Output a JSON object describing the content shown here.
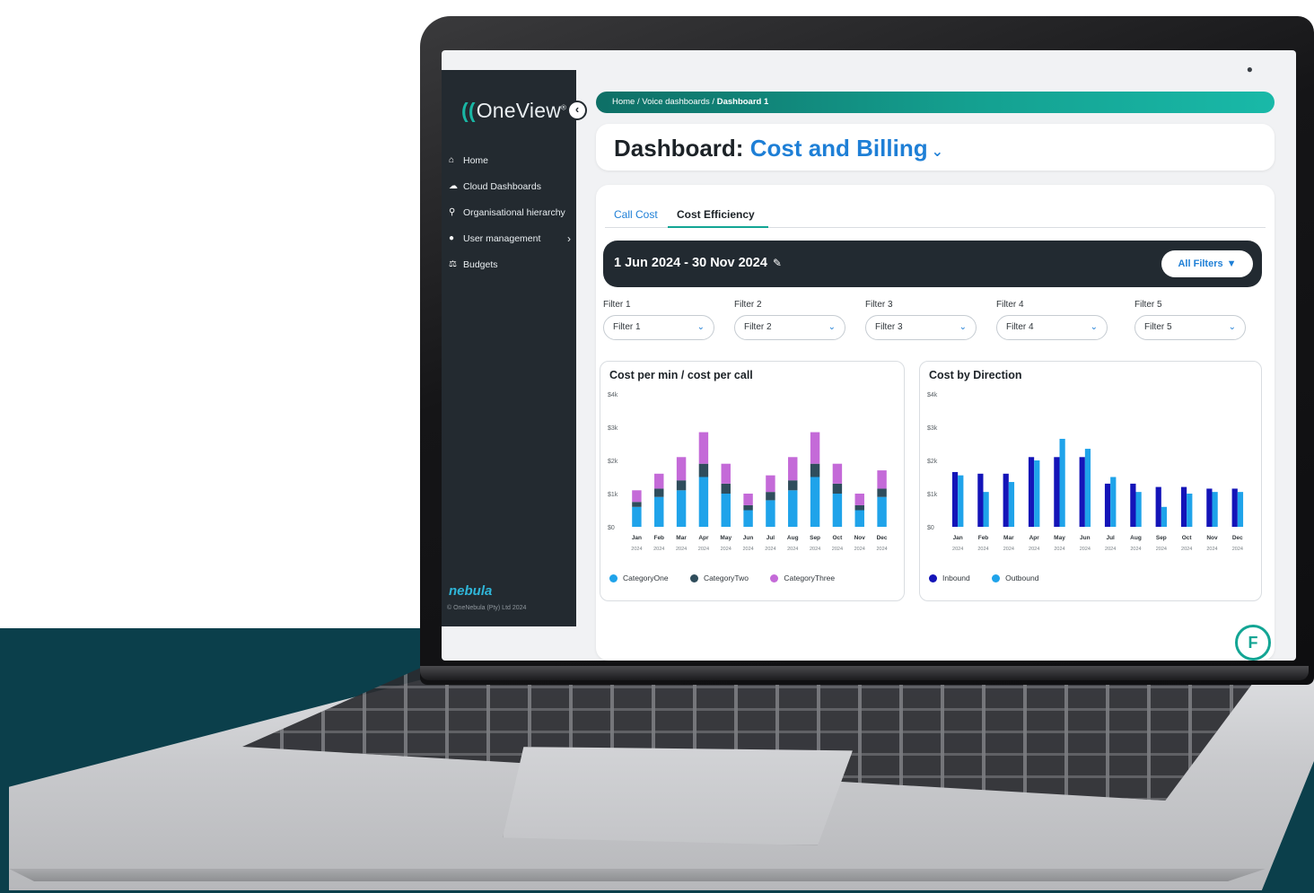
{
  "app": {
    "name": "OneView",
    "brand_footer": "nebula",
    "copyright": "© OneNebula (Pty) Ltd 2024",
    "accent_color": "#1e7fd6",
    "teal_color": "#13a594",
    "sidebar_color": "#232a30"
  },
  "sidebar": {
    "items": [
      {
        "label": "Home",
        "icon": "home-icon"
      },
      {
        "label": "Cloud Dashboards",
        "icon": "cloud-icon"
      },
      {
        "label": "Organisational hierarchy",
        "icon": "hierarchy-icon"
      },
      {
        "label": "User management",
        "icon": "users-icon"
      },
      {
        "label": "Budgets",
        "icon": "scale-icon"
      }
    ]
  },
  "breadcrumb": {
    "home": "Home",
    "section": "Voice dashboards",
    "current": "Dashboard 1",
    "separator": " / "
  },
  "header": {
    "prefix": "Dashboard:",
    "dashboard_name": "Cost and Billing"
  },
  "tabs": [
    {
      "label": "Call Cost",
      "active": false
    },
    {
      "label": "Cost Efficiency",
      "active": true
    }
  ],
  "date_range": {
    "label": "1 Jun 2024 - 30 Nov 2024",
    "filters_button": "All Filters"
  },
  "filters": [
    {
      "label": "Filter 1",
      "value": "Filter 1"
    },
    {
      "label": "Filter 2",
      "value": "Filter 2"
    },
    {
      "label": "Filter 3",
      "value": "Filter 3"
    },
    {
      "label": "Filter 4",
      "value": "Filter 4"
    },
    {
      "label": "Filter 5",
      "value": "Filter 5"
    }
  ],
  "chart_data": [
    {
      "type": "bar",
      "stacked": true,
      "title": "Cost per min / cost per call",
      "categories": [
        "Jan",
        "Feb",
        "Mar",
        "Apr",
        "May",
        "Jun",
        "Jul",
        "Aug",
        "Sep",
        "Oct",
        "Nov",
        "Dec"
      ],
      "sub_labels": [
        "2024",
        "2024",
        "2024",
        "2024",
        "2024",
        "2024",
        "2024",
        "2024",
        "2024",
        "2024",
        "2024",
        "2024"
      ],
      "yticks": [
        "$0",
        "$1k",
        "$2k",
        "$3k",
        "$4k"
      ],
      "ylim": [
        0,
        4000
      ],
      "grid": false,
      "legend_position": "bottom-left",
      "series": [
        {
          "name": "CategoryOne",
          "color": "#1fa3ea",
          "values": [
            600,
            900,
            1100,
            1500,
            1000,
            500,
            800,
            1100,
            1500,
            1000,
            500,
            900
          ]
        },
        {
          "name": "CategoryTwo",
          "color": "#2f4d5c",
          "values": [
            150,
            250,
            300,
            400,
            300,
            150,
            250,
            300,
            400,
            300,
            150,
            250
          ]
        },
        {
          "name": "CategoryThree",
          "color": "#c46ad8",
          "values": [
            350,
            450,
            700,
            950,
            600,
            350,
            500,
            700,
            950,
            600,
            350,
            550
          ]
        }
      ]
    },
    {
      "type": "bar",
      "stacked": false,
      "title": "Cost by Direction",
      "categories": [
        "Jan",
        "Feb",
        "Mar",
        "Apr",
        "May",
        "Jun",
        "Jul",
        "Aug",
        "Sep",
        "Oct",
        "Nov",
        "Dec"
      ],
      "sub_labels": [
        "2024",
        "2024",
        "2024",
        "2024",
        "2024",
        "2024",
        "2024",
        "2024",
        "2024",
        "2024",
        "2024",
        "2024"
      ],
      "yticks": [
        "$0",
        "$1k",
        "$2k",
        "$3k",
        "$4k"
      ],
      "ylim": [
        0,
        4000
      ],
      "grid": false,
      "legend_position": "bottom-left",
      "series": [
        {
          "name": "Inbound",
          "color": "#1414b8",
          "values": [
            1650,
            1600,
            1600,
            2100,
            2100,
            2100,
            1300,
            1300,
            1200,
            1200,
            1150,
            1150
          ]
        },
        {
          "name": "Outbound",
          "color": "#1fa3ea",
          "values": [
            1550,
            1050,
            1350,
            2000,
            2650,
            2350,
            1500,
            1050,
            600,
            1000,
            1050,
            1050
          ]
        }
      ]
    }
  ]
}
